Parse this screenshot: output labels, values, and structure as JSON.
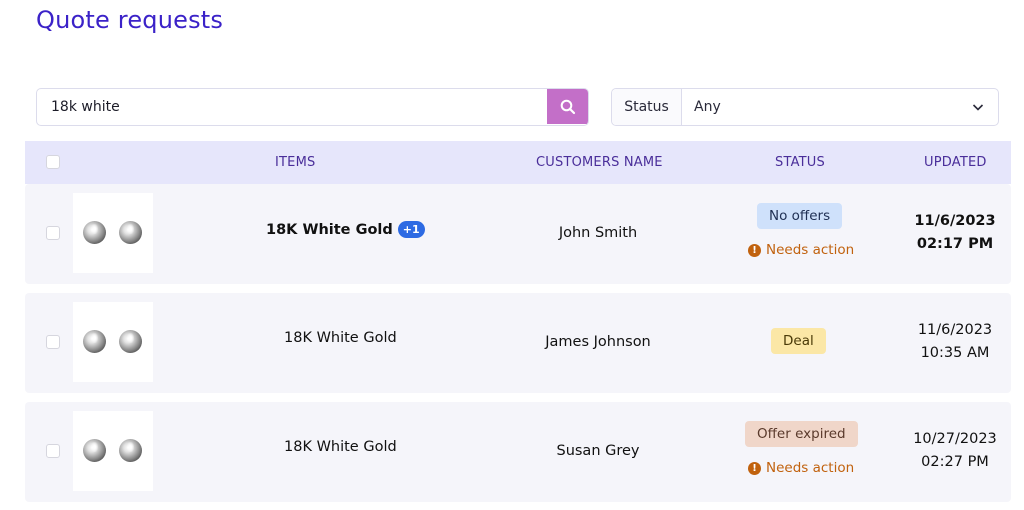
{
  "page": {
    "title": "Quote requests"
  },
  "search": {
    "value": "18k white",
    "button_icon": "search-icon",
    "accent": "#c36fc8"
  },
  "status_filter": {
    "label": "Status",
    "selected": "Any"
  },
  "table": {
    "headers": {
      "items": "ITEMS",
      "customer": "CUSTOMERS NAME",
      "status": "STATUS",
      "updated": "UPDATED"
    },
    "rows": [
      {
        "item": "18K White Gold",
        "extra": "+1",
        "customer": "John Smith",
        "status": "No offers",
        "action": "Needs action",
        "date": "11/6/2023",
        "time": "02:17 PM"
      },
      {
        "item": "18K White Gold",
        "customer": "James Johnson",
        "status": "Deal",
        "date": "11/6/2023",
        "time": "10:35 AM"
      },
      {
        "item": "18K White Gold",
        "customer": "Susan Grey",
        "status": "Offer expired",
        "action": "Needs action",
        "date": "10/27/2023",
        "time": "02:27 PM"
      }
    ]
  },
  "colors": {
    "title": "#3b22c8",
    "header_bg": "#e6e6fb",
    "row_bg": "#f5f5fa",
    "needs_action": "#c1620e",
    "plus_badge": "#2d6ae3"
  }
}
